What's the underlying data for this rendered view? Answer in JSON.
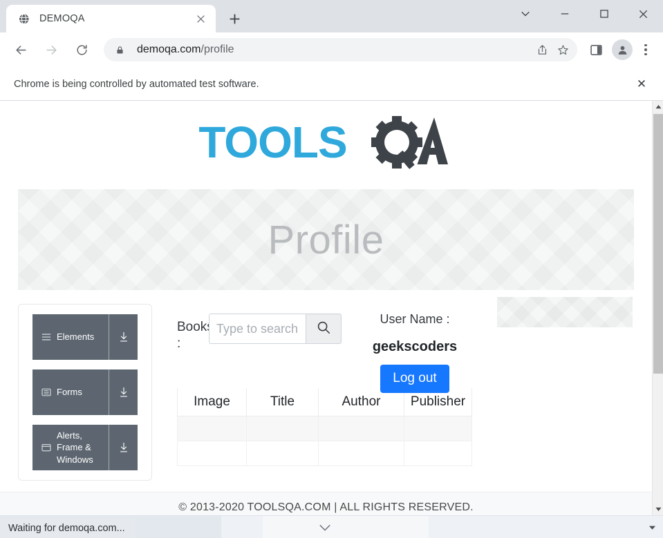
{
  "browser": {
    "tab": {
      "title": "DEMOQA",
      "favicon_icon": "globe-icon",
      "close_icon": "close-icon"
    },
    "new_tab_icon": "plus-icon",
    "window_controls": {
      "collapse_icon": "chevron-down-icon",
      "minimize_icon": "minimize-icon",
      "maximize_icon": "maximize-icon",
      "close_icon": "close-icon"
    },
    "toolbar": {
      "back_icon": "arrow-left-icon",
      "forward_icon": "arrow-right-icon",
      "reload_icon": "reload-icon",
      "lock_icon": "lock-icon",
      "url_domain": "demoqa.com",
      "url_path": "/profile",
      "share_icon": "share-icon",
      "bookmark_icon": "star-icon",
      "sidepanel_icon": "side-panel-icon",
      "profile_icon": "person-icon",
      "menu_icon": "three-dots-icon"
    },
    "infobar": {
      "message": "Chrome is being controlled by automated test software.",
      "close_label": "✕"
    },
    "status": {
      "text": "Waiting for demoqa.com..."
    },
    "scrollbar": {
      "up_icon": "scroll-up-arrow-icon",
      "down_icon": "scroll-down-arrow-icon"
    }
  },
  "page": {
    "logo": {
      "text_primary": "TOOLS",
      "text_secondary": "QA",
      "color_primary": "#2fa8dc",
      "color_secondary": "#3d4349"
    },
    "banner": {
      "title": "Profile"
    },
    "sidebar": {
      "items": [
        {
          "label": "Elements",
          "icon": "hamburger-menu-icon",
          "expand_icon": "arrow-down-icon"
        },
        {
          "label": "Forms",
          "icon": "form-icon",
          "expand_icon": "arrow-down-icon"
        },
        {
          "label": "Alerts, Frame & Windows",
          "icon": "window-icon",
          "expand_icon": "arrow-down-icon"
        }
      ]
    },
    "profile": {
      "user_label": "User Name :",
      "user_name": "geekscoders",
      "logout_label": "Log out",
      "logout_color": "#1677ff"
    },
    "books": {
      "label": "Books :",
      "search_placeholder": "Type to search",
      "search_value": "",
      "search_icon": "search-icon",
      "columns": [
        "Image",
        "Title",
        "Author",
        "Publisher"
      ],
      "rows": [
        [
          "",
          "",
          "",
          ""
        ],
        [
          "",
          "",
          "",
          ""
        ]
      ]
    },
    "footer": {
      "text": "© 2013-2020 TOOLSQA.COM | ALL RIGHTS RESERVED."
    }
  },
  "os": {
    "chevron_icon": "chevron-down-icon",
    "caret_icon": "caret-down-icon"
  }
}
